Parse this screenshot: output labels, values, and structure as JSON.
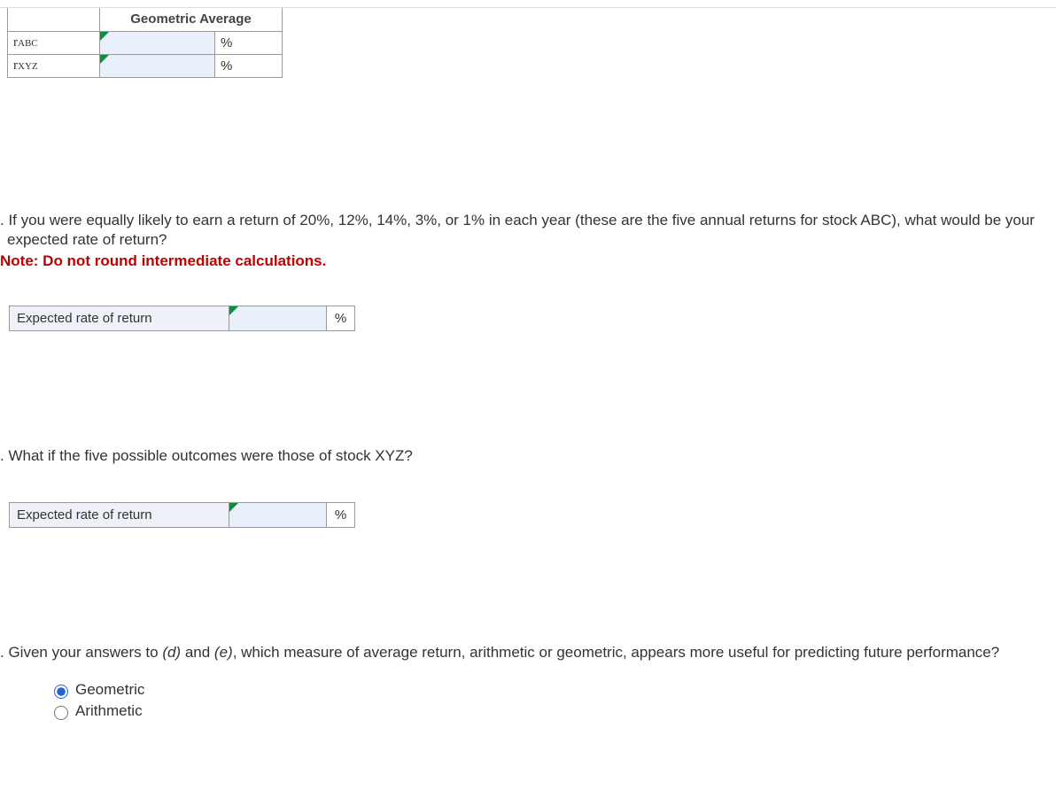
{
  "geoTable": {
    "header": "Geometric Average",
    "rows": [
      {
        "labelMain": "r",
        "labelSub": "ABC",
        "value": "",
        "unit": "%"
      },
      {
        "labelMain": "r",
        "labelSub": "XYZ",
        "value": "",
        "unit": "%"
      }
    ]
  },
  "qd": {
    "prompt": ". If you were equally likely to earn a return of 20%, 12%, 14%, 3%, or 1% in each year (these are the five annual returns for stock ABC), what would be your expected rate of return?",
    "note": "Note: Do not round intermediate calculations.",
    "rowLabel": "Expected rate of return",
    "value": "",
    "unit": "%"
  },
  "qe": {
    "prompt": ". What if the five possible outcomes were those of stock XYZ?",
    "rowLabel": "Expected rate of return",
    "value": "",
    "unit": "%"
  },
  "qf": {
    "promptPre": ". Given your answers to ",
    "italD": "(d)",
    "mid": " and ",
    "italE": "(e)",
    "promptPost": ", which measure of average return, arithmetic or geometric, appears more useful for predicting future performance?",
    "options": {
      "geometric": "Geometric",
      "arithmetic": "Arithmetic"
    }
  }
}
